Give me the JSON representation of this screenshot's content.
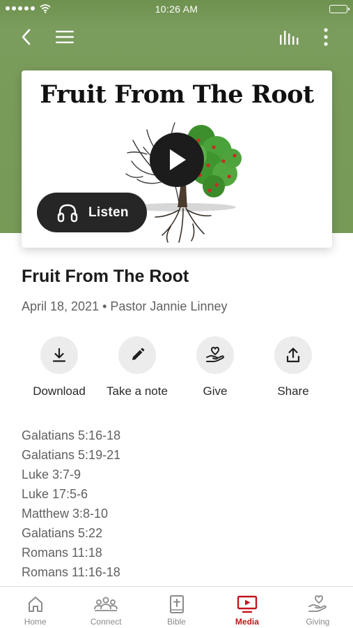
{
  "status_bar": {
    "time": "10:26 AM"
  },
  "nav": {
    "back_icon": "chevron-left-icon",
    "menu_icon": "hamburger-menu-icon",
    "audio_icon": "audio-levels-icon",
    "more_icon": "vertical-dots-icon"
  },
  "artwork": {
    "title": "Fruit From The Root",
    "play_icon": "play-icon",
    "listen_label": "Listen",
    "listen_icon": "headphones-icon"
  },
  "sermon": {
    "title": "Fruit From The Root",
    "meta": "April 18, 2021 • Pastor Jannie Linney"
  },
  "actions": [
    {
      "label": "Download",
      "icon": "download-icon"
    },
    {
      "label": "Take a note",
      "icon": "pencil-icon"
    },
    {
      "label": "Give",
      "icon": "hand-heart-icon"
    },
    {
      "label": "Share",
      "icon": "share-icon"
    }
  ],
  "scriptures": [
    "Galatians 5:16-18",
    "Galatians 5:19-21",
    "Luke 3:7-9",
    "Luke 17:5-6",
    "Matthew 3:8-10",
    "Galatians 5:22",
    "Romans 11:18",
    "Romans 11:16-18"
  ],
  "tabs": [
    {
      "label": "Home",
      "icon": "home-icon",
      "active": false
    },
    {
      "label": "Connect",
      "icon": "people-icon",
      "active": false
    },
    {
      "label": "Bible",
      "icon": "bible-icon",
      "active": false
    },
    {
      "label": "Media",
      "icon": "media-play-icon",
      "active": true
    },
    {
      "label": "Giving",
      "icon": "giving-hand-icon",
      "active": false
    }
  ],
  "colors": {
    "hero_green": "#779a57",
    "accent_red": "#c2161c",
    "tab_inactive": "#8a8a8a"
  }
}
